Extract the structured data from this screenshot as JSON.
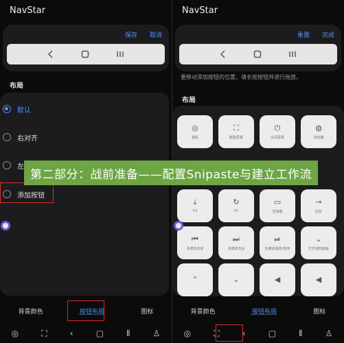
{
  "left": {
    "app_title": "NavStar",
    "actions": {
      "save": "保存",
      "cancel": "取消"
    },
    "section_title": "布局",
    "options": [
      {
        "label": "默认",
        "checked": true
      },
      {
        "label": "右对齐",
        "checked": false
      },
      {
        "label": "左",
        "checked": false
      },
      {
        "label": "添加按钮",
        "checked": false
      }
    ],
    "tabs": [
      "背景颜色",
      "按钮布局",
      "图标"
    ],
    "active_tab": "按钮布局"
  },
  "right": {
    "app_title": "NavStar",
    "actions": {
      "reset": "重置",
      "done": "完成"
    },
    "hint": "要移动添加按钮的位置，请长按按钮并进行拖放。",
    "section_title": "布局",
    "tiles": [
      {
        "icon": "camera-icon",
        "glyph": "◎",
        "label": "相机"
      },
      {
        "icon": "screenshot-icon",
        "glyph": "⛶",
        "label": "截取屏幕"
      },
      {
        "icon": "power-icon",
        "glyph": "⏻",
        "label": "关闭屏幕"
      },
      {
        "icon": "globe-icon",
        "glyph": "◍",
        "label": "浏览器"
      },
      {
        "icon": "a-icon",
        "glyph": "",
        "label": ""
      },
      {
        "icon": "b-icon",
        "glyph": "",
        "label": ""
      },
      {
        "icon": "c-icon",
        "glyph": "",
        "label": ""
      },
      {
        "icon": "d-icon",
        "glyph": "",
        "label": ""
      },
      {
        "icon": "f4-icon",
        "glyph": "⤓",
        "label": "F4"
      },
      {
        "icon": "f5-icon",
        "glyph": "↻",
        "label": "F5"
      },
      {
        "icon": "space-icon",
        "glyph": "▭",
        "label": "空格键"
      },
      {
        "icon": "enter-icon",
        "glyph": "→",
        "label": "回车"
      },
      {
        "icon": "rewind-icon",
        "glyph": "⏮",
        "label": "多媒体向前"
      },
      {
        "icon": "forward-icon",
        "glyph": "⏭",
        "label": "多媒体向后"
      },
      {
        "icon": "playpause-icon",
        "glyph": "⏯",
        "label": "多媒体播放/暂停"
      },
      {
        "icon": "notification-icon",
        "glyph": "⌄",
        "label": "打开通知面板"
      },
      {
        "icon": "chevron-up-icon",
        "glyph": "⌃",
        "label": ""
      },
      {
        "icon": "chevron-down-icon",
        "glyph": "⌄",
        "label": ""
      },
      {
        "icon": "volume-down-icon",
        "glyph": "◀",
        "label": ""
      },
      {
        "icon": "volume-up-icon",
        "glyph": "◀",
        "label": ""
      }
    ],
    "tabs": [
      "背景颜色",
      "按钮布局",
      "图标"
    ],
    "active_tab": "按钮布局"
  },
  "banner": "第二部分：战前准备——配置Snipaste与建立工作流",
  "colors": {
    "accent": "#4f8ff7",
    "highlight": "#e02b2b",
    "banner": "#6ea545"
  }
}
